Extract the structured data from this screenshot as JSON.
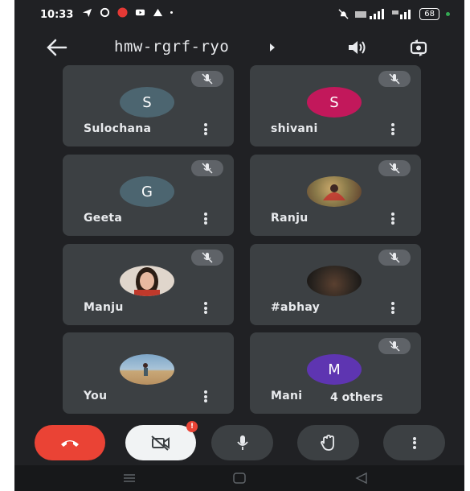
{
  "status_bar": {
    "time": "10:33",
    "battery": "68"
  },
  "header": {
    "meeting_code": "hmw-rgrf-ryo"
  },
  "participants": [
    {
      "name": "Sulochana",
      "initial": "S",
      "avatar_color": "#4c6570"
    },
    {
      "name": "shivani",
      "initial": "S",
      "avatar_color": "#c2185b"
    },
    {
      "name": "Geeta",
      "initial": "G",
      "avatar_color": "#4c6570"
    },
    {
      "name": "Ranju",
      "initial": "",
      "avatar_color": "#8a7a4a"
    },
    {
      "name": "Manju",
      "initial": "",
      "avatar_color": "#a58f80"
    },
    {
      "name": "#abhay",
      "initial": "",
      "avatar_color": "#2b2520"
    },
    {
      "name": "You",
      "initial": "",
      "avatar_color": "#7ea6c8"
    },
    {
      "name": "Mani",
      "initial": "M",
      "avatar_color": "#5e35b1"
    }
  ],
  "others_chip": "4 others",
  "controls": {
    "camera_badge": "!"
  },
  "colors": {
    "end_call": "#ea4335",
    "background": "#202124",
    "tile": "#3c4043",
    "control_button": "#3c4043"
  }
}
